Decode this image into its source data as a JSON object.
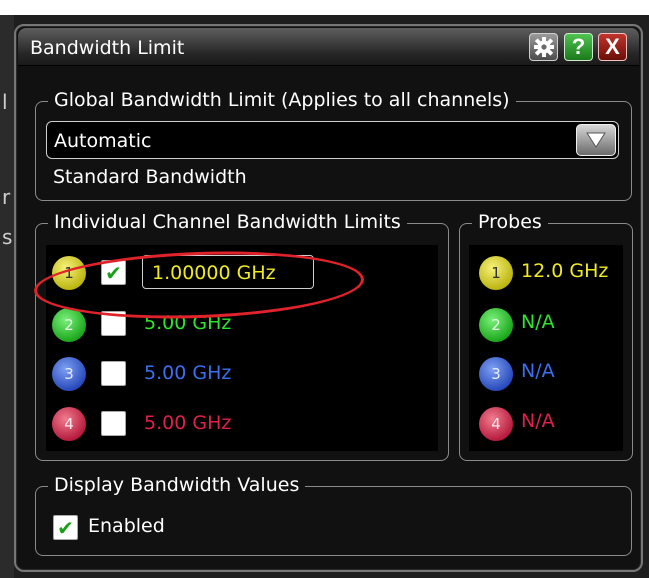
{
  "dialog": {
    "title": "Bandwidth Limit",
    "buttons": {
      "settings_icon": "gear-icon",
      "help_label": "?",
      "close_label": "X"
    }
  },
  "global": {
    "legend": "Global Bandwidth Limit (Applies to all channels)",
    "select_value": "Automatic",
    "description": "Standard Bandwidth"
  },
  "individual": {
    "legend": "Individual Channel Bandwidth Limits",
    "channels": [
      {
        "number": "1",
        "checked": true,
        "value": "1.00000 GHz",
        "color": "#f0ea20"
      },
      {
        "number": "2",
        "checked": false,
        "value": "5.00 GHz",
        "color": "#2ee52e"
      },
      {
        "number": "3",
        "checked": false,
        "value": "5.00 GHz",
        "color": "#3a6ff0"
      },
      {
        "number": "4",
        "checked": false,
        "value": "5.00 GHz",
        "color": "#e0204a"
      }
    ]
  },
  "probes": {
    "legend": "Probes",
    "items": [
      {
        "number": "1",
        "value": "12.0 GHz",
        "color": "#f0ea20"
      },
      {
        "number": "2",
        "value": "N/A",
        "color": "#2ee52e"
      },
      {
        "number": "3",
        "value": "N/A",
        "color": "#3a6ff0"
      },
      {
        "number": "4",
        "value": "N/A",
        "color": "#e0204a"
      }
    ]
  },
  "display": {
    "legend": "Display Bandwidth Values",
    "enabled_label": "Enabled",
    "enabled_checked": true
  },
  "check_glyph": "✔"
}
